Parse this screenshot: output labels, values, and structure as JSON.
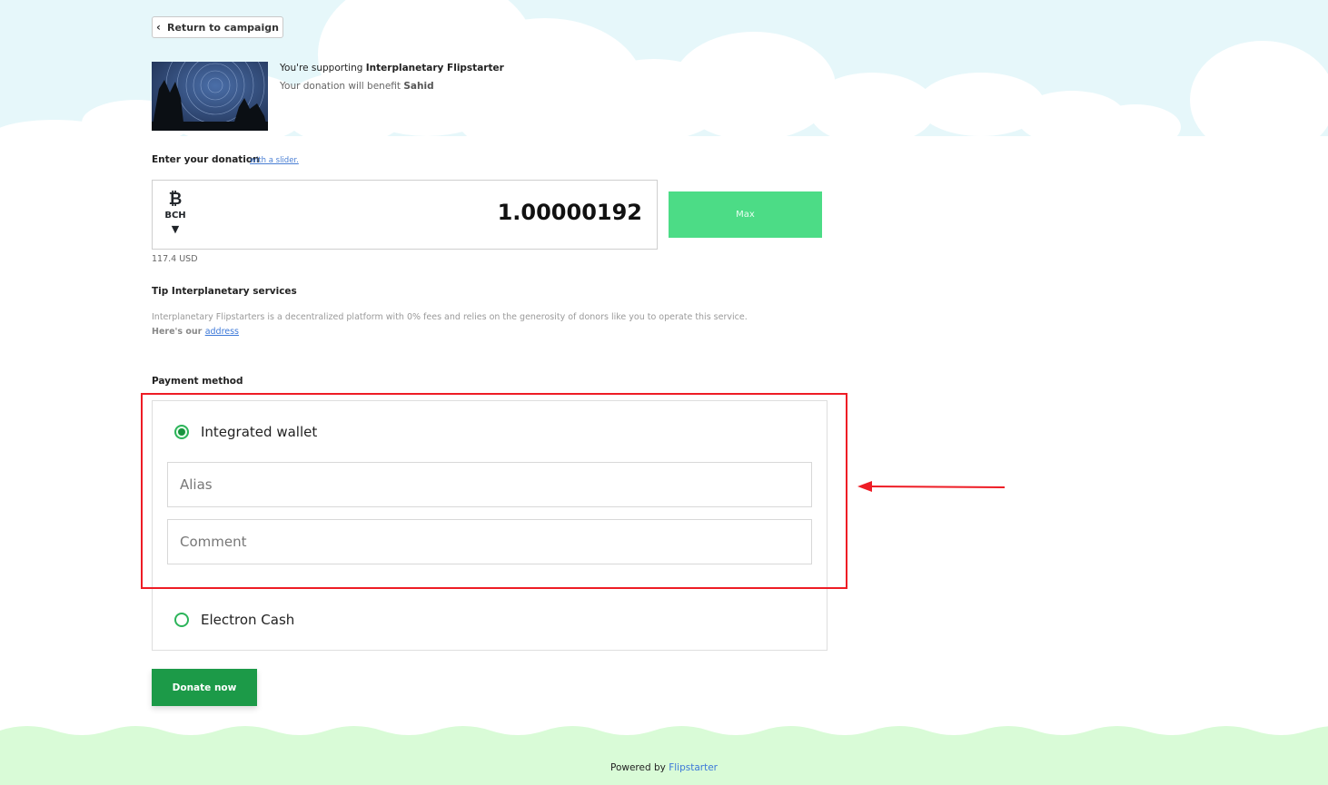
{
  "nav": {
    "back_label": "Return to campaign"
  },
  "campaign": {
    "supporting_prefix": "You're supporting ",
    "name": "Interplanetary Flipstarter",
    "benefit_prefix": "Your donation will benefit ",
    "beneficiary": "Sahid"
  },
  "donation": {
    "label": "Enter your donation",
    "slider_link": "with a slider.",
    "currency_symbol": "₿",
    "currency_code": "BCH",
    "currency_arrow": "▼",
    "amount": "1.00000192",
    "max_label": "Max",
    "usd": "117.4 USD"
  },
  "tip": {
    "title": "Tip Interplanetary services",
    "description": "Interplanetary Flipstarters is a decentralized platform with 0% fees and relies on the generosity of donors like you to operate this service.",
    "address_prefix": "Here's our ",
    "address_link": "address"
  },
  "payment": {
    "label": "Payment method",
    "options": [
      {
        "label": "Integrated wallet",
        "selected": true
      },
      {
        "label": "Electron Cash",
        "selected": false
      }
    ],
    "alias_placeholder": "Alias",
    "comment_placeholder": "Comment"
  },
  "actions": {
    "donate_label": "Donate now"
  },
  "footer": {
    "powered_prefix": "Powered by ",
    "brand": "Flipstarter"
  },
  "colors": {
    "accent_green": "#1c9a48",
    "max_green": "#4cdc86",
    "sky": "#e6f7fa",
    "grass": "#d9fbd7",
    "highlight_red": "#ee1c25"
  }
}
